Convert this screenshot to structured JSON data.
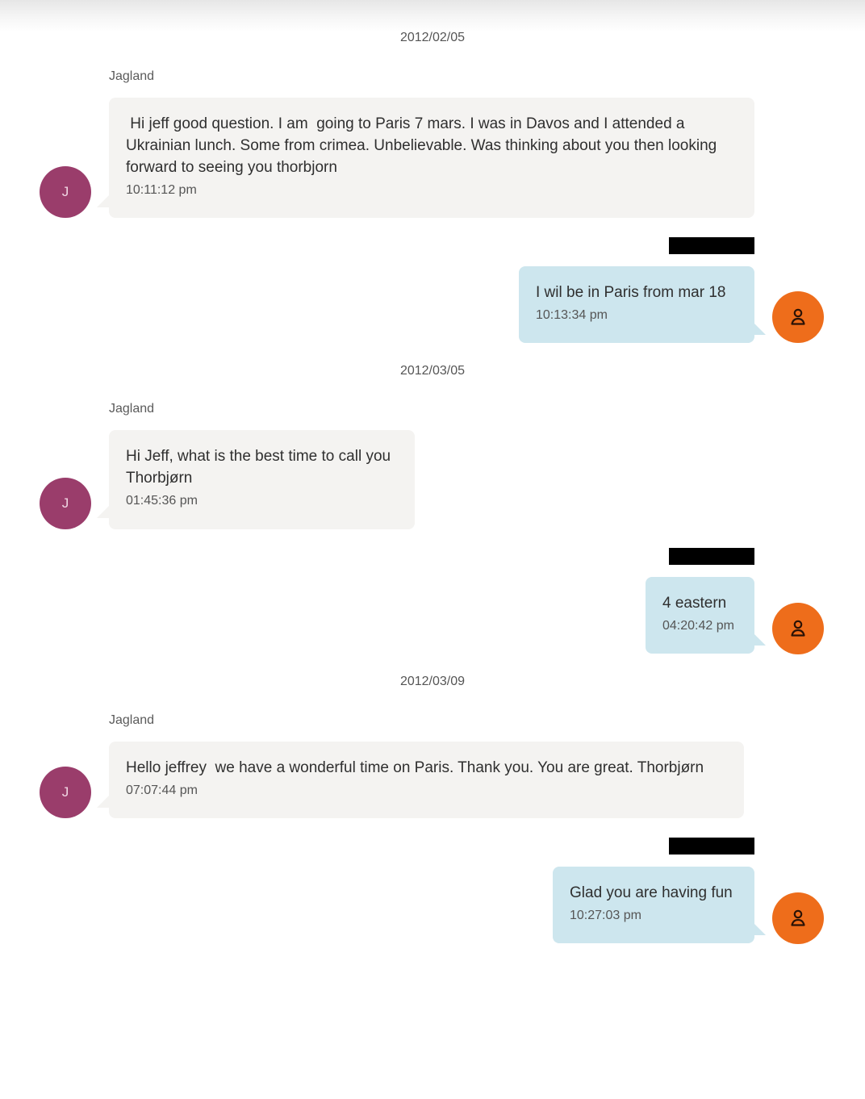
{
  "colors": {
    "incoming_bubble": "#f4f3f1",
    "outgoing_bubble": "#cde6ee",
    "sender_avatar": "#9a3d6b",
    "user_avatar": "#ee6d1b",
    "redaction": "#000000"
  },
  "conversation": [
    {
      "date": "2012/02/05",
      "messages": [
        {
          "direction": "incoming",
          "sender": "Jagland",
          "avatar_initial": "J",
          "text": " Hi jeff good question. I am  going to Paris 7 mars. I was in Davos and I attended a Ukrainian lunch. Some from crimea. Unbelievable. Was thinking about you then looking forward to seeing you thorbjorn",
          "time": "10:11:12 pm"
        },
        {
          "direction": "outgoing",
          "sender_redacted": true,
          "avatar_icon": "person-icon",
          "text": "I wil be in Paris from mar 18",
          "time": "10:13:34 pm"
        }
      ]
    },
    {
      "date": "2012/03/05",
      "messages": [
        {
          "direction": "incoming",
          "sender": "Jagland",
          "avatar_initial": "J",
          "text": "Hi Jeff, what is the best time to call you Thorbjørn",
          "time": "01:45:36 pm"
        },
        {
          "direction": "outgoing",
          "sender_redacted": true,
          "avatar_icon": "person-icon",
          "text": "4 eastern",
          "time": "04:20:42 pm"
        }
      ]
    },
    {
      "date": "2012/03/09",
      "messages": [
        {
          "direction": "incoming",
          "sender": "Jagland",
          "avatar_initial": "J",
          "text": "Hello jeffrey  we have a wonderful time on Paris. Thank you. You are great. Thorbjørn",
          "time": "07:07:44 pm"
        },
        {
          "direction": "outgoing",
          "sender_redacted": true,
          "avatar_icon": "person-icon",
          "text": "Glad you are having fun",
          "time": "10:27:03 pm"
        }
      ]
    }
  ]
}
